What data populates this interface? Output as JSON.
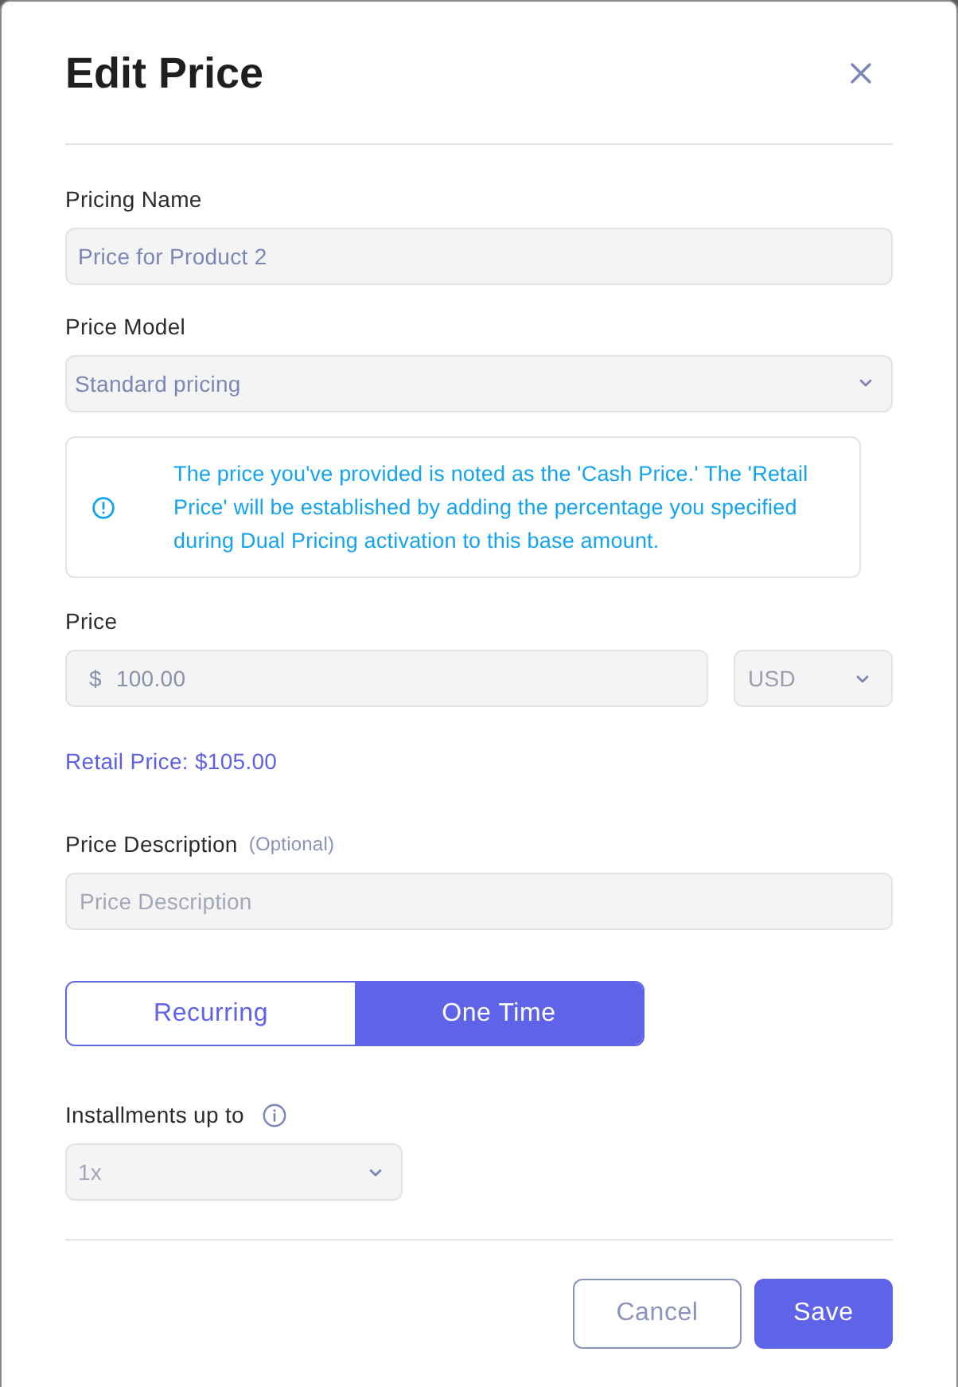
{
  "title": "Edit Price",
  "pricing_name": {
    "label": "Pricing Name",
    "value": "Price for Product 2"
  },
  "price_model": {
    "label": "Price Model",
    "value": "Standard pricing"
  },
  "notice": {
    "text": "The price you've provided is noted as the 'Cash Price.' The 'Retail Price' will be established by adding the percentage you specified during Dual Pricing activation to this base amount."
  },
  "price": {
    "label": "Price",
    "symbol": "$",
    "value": "100.00",
    "currency": "USD"
  },
  "retail_price": "Retail Price: $105.00",
  "price_description": {
    "label": "Price Description",
    "optional": "(Optional)",
    "placeholder": "Price Description"
  },
  "billing_type": [
    {
      "label": "Recurring",
      "selected": false
    },
    {
      "label": "One Time",
      "selected": true
    }
  ],
  "installments": {
    "label": "Installments up to",
    "value": "1x",
    "disabled": true
  },
  "buttons": [
    {
      "label": "Cancel",
      "kind": "secondary"
    },
    {
      "label": "Save",
      "kind": "primary"
    }
  ]
}
